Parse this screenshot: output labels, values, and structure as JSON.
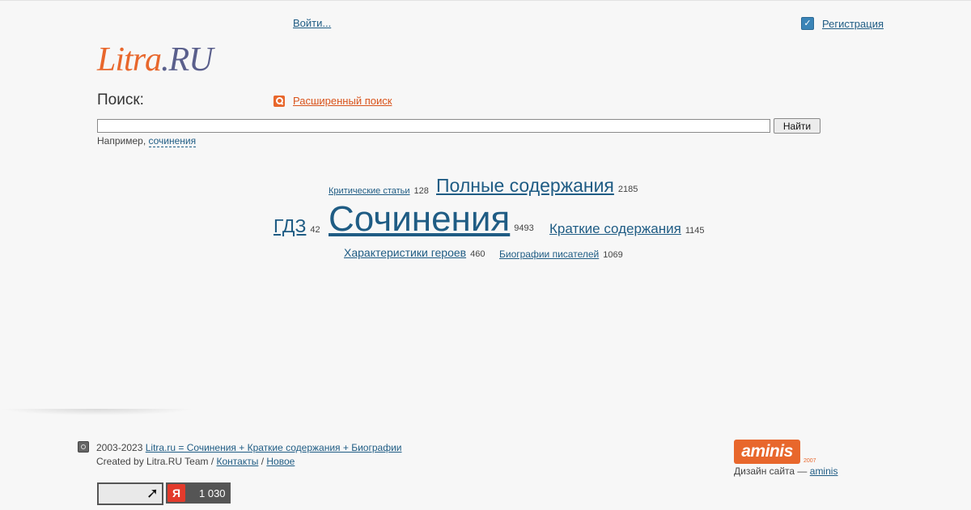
{
  "header": {
    "login": "Войти...",
    "register": "Регистрация"
  },
  "logo": {
    "part1": "Litra",
    "part2": ".RU"
  },
  "search": {
    "label": "Поиск:",
    "advanced": "Расширенный поиск",
    "input_value": "",
    "button": "Найти",
    "example_prefix": "Например,",
    "example_link": "сочинения"
  },
  "tags": [
    {
      "label": "Критические статьи",
      "count": "128"
    },
    {
      "label": "Полные содержания",
      "count": "2185"
    },
    {
      "label": "ГДЗ",
      "count": "42"
    },
    {
      "label": "Сочинения",
      "count": "9493"
    },
    {
      "label": "Краткие содержания",
      "count": "1145"
    },
    {
      "label": "Характеристики героев",
      "count": "460"
    },
    {
      "label": "Биографии писателей",
      "count": "1069"
    }
  ],
  "footer": {
    "years": "2003-2023",
    "site_link": "Litra.ru = Сочинения + Краткие содержания + Биографии",
    "created_by": "Created by Litra.RU Team /",
    "contacts": "Контакты",
    "slash": "/",
    "news": "Новое",
    "metrica_count": "1 030",
    "design_prefix": "Дизайн сайта —",
    "design_link": "aminis",
    "aminis_logo": "aminis",
    "aminis_year": "2007"
  },
  "icons": {
    "checkbox": "checkbox-icon",
    "advanced_search": "magnifier-icon",
    "copyright": "copyright-icon",
    "counter_arrow": "arrow-up-right-icon",
    "yandex_metrica": "yandex-metrica-icon"
  },
  "colors": {
    "link": "#1f5c84",
    "accent_orange": "#e8672c",
    "logo_purple": "#5a5f8c"
  }
}
